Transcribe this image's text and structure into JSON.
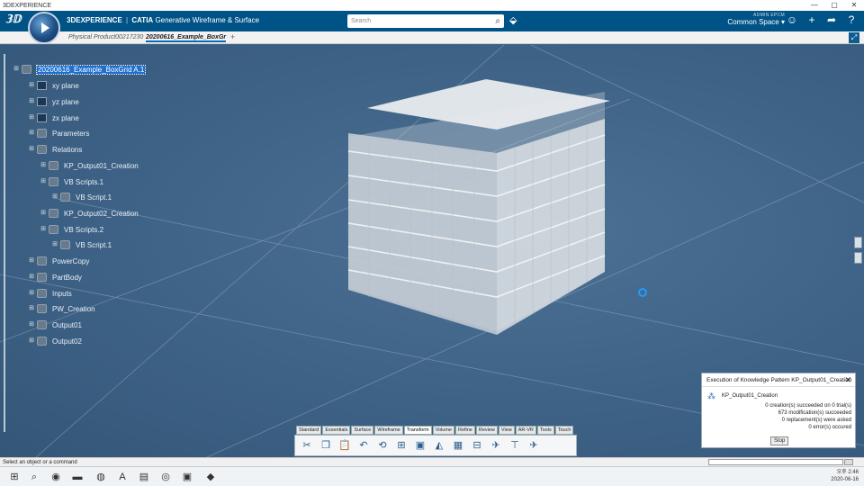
{
  "window": {
    "title": "3DEXPERIENCE",
    "controls": [
      "—",
      "▢",
      "✕"
    ]
  },
  "header": {
    "brand_bold": "3DEXPERIENCE",
    "brand_sep": "|",
    "brand_app": "CATIA",
    "brand_app_desc": "Generative Wireframe & Surface",
    "search_placeholder": "Search",
    "user": "ADMIN EPCM",
    "space": "Common Space ▾",
    "icons": [
      "user-icon",
      "plus-icon",
      "share-icon",
      "help-icon"
    ]
  },
  "tabs": [
    {
      "label": "Physical Product00217230",
      "active": false
    },
    {
      "label": "20200616_Example_BoxGr",
      "active": true
    }
  ],
  "tree": [
    {
      "label": "20200616_Example_BoxGrid A.1",
      "depth": 0,
      "selected": true
    },
    {
      "label": "xy plane",
      "depth": 1
    },
    {
      "label": "yz plane",
      "depth": 1
    },
    {
      "label": "zx plane",
      "depth": 1
    },
    {
      "label": "Parameters",
      "depth": 1
    },
    {
      "label": "Relations",
      "depth": 1
    },
    {
      "label": "KP_Output01_Creation",
      "depth": 2
    },
    {
      "label": "VB Scripts.1",
      "depth": 2
    },
    {
      "label": "VB Script.1",
      "depth": 3
    },
    {
      "label": "KP_Output02_Creation",
      "depth": 2
    },
    {
      "label": "VB Scripts.2",
      "depth": 2
    },
    {
      "label": "VB Script.1",
      "depth": 3
    },
    {
      "label": "PowerCopy",
      "depth": 1
    },
    {
      "label": "PartBody",
      "depth": 1
    },
    {
      "label": "Inputs",
      "depth": 1
    },
    {
      "label": "PW_Creation",
      "depth": 1
    },
    {
      "label": "Output01",
      "depth": 1
    },
    {
      "label": "Output02",
      "depth": 1
    }
  ],
  "dialog": {
    "title": "Execution of Knowledge Pattern KP_Output01_Creation",
    "pattern": "KP_Output01_Creation",
    "lines": [
      "0 creation(s) succeeded on 0 trial(s)",
      "673 modification(s) succeeded",
      "0 replacement(s) were asked",
      "0 error(s) occured"
    ],
    "stop_label": "Stop"
  },
  "action_bar": {
    "tabs": [
      "Standard",
      "Essentials",
      "Surface",
      "Wireframe",
      "Transform",
      "Volume",
      "Refine",
      "Review",
      "View",
      "AR-VR",
      "Tools",
      "Touch"
    ],
    "active_tab": "Transform",
    "tools": [
      "✂",
      "❐",
      "📋",
      "↶",
      "⟲",
      "⊞",
      "▣",
      "◭",
      "▦",
      "⊟",
      "✈",
      "⊤",
      "✈"
    ]
  },
  "status": {
    "prompt": "Select an object or a command"
  },
  "taskbar": {
    "icons": [
      "⊞",
      "⌕",
      "◉",
      "▬",
      "◍",
      "A",
      "▤",
      "◎",
      "▣",
      "◆"
    ],
    "time": "오후 2:46",
    "date": "2020-06-16"
  },
  "colors": {
    "viewport": "#3f6588",
    "header": "#005386",
    "selection": "#1f6fd0"
  }
}
